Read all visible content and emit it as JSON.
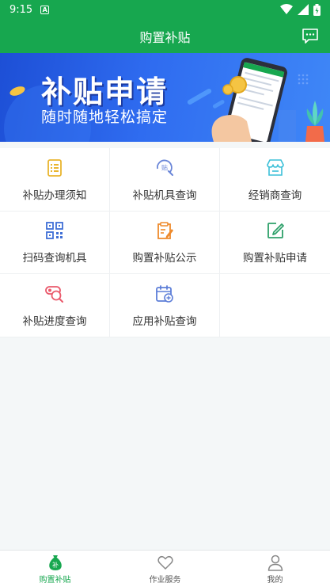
{
  "status_bar": {
    "time": "9:15",
    "notification_badge": "A"
  },
  "header": {
    "title": "购置补贴"
  },
  "banner": {
    "title": "补贴申请",
    "subtitle": "随时随地轻松搞定"
  },
  "menu": [
    {
      "label": "补贴办理须知",
      "icon": "document-list-icon"
    },
    {
      "label": "补贴机具查询",
      "icon": "subsidy-search-icon"
    },
    {
      "label": "经销商查询",
      "icon": "store-icon"
    },
    {
      "label": "扫码查询机具",
      "icon": "qr-code-icon"
    },
    {
      "label": "购置补贴公示",
      "icon": "clipboard-edit-icon"
    },
    {
      "label": "购置补贴申请",
      "icon": "edit-square-icon"
    },
    {
      "label": "补贴进度查询",
      "icon": "progress-search-icon"
    },
    {
      "label": "应用补贴查询",
      "icon": "calendar-icon"
    }
  ],
  "bottom_nav": [
    {
      "label": "购置补贴",
      "icon": "money-bag-icon",
      "active": true
    },
    {
      "label": "作业服务",
      "icon": "heart-icon",
      "active": false
    },
    {
      "label": "我的",
      "icon": "user-icon",
      "active": false
    }
  ],
  "colors": {
    "primary": "#17a74f",
    "banner": "#2f6cf0"
  }
}
